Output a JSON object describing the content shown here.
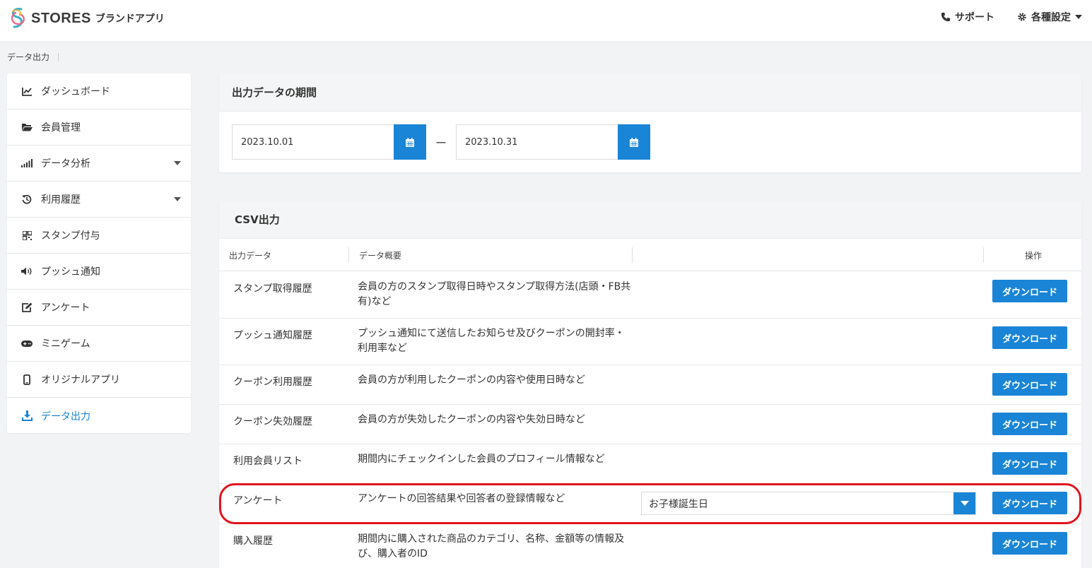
{
  "header": {
    "brand": "STORES",
    "brand_sub": "ブランドアプリ",
    "support_label": "サポート",
    "settings_label": "各種設定"
  },
  "breadcrumb": {
    "current": "データ出力"
  },
  "sidebar": {
    "items": [
      {
        "label": "ダッシュボード",
        "icon": "chart-line-icon"
      },
      {
        "label": "会員管理",
        "icon": "folder-icon"
      },
      {
        "label": "データ分析",
        "icon": "signal-bars-icon"
      },
      {
        "label": "利用履歴",
        "icon": "history-icon"
      },
      {
        "label": "スタンプ付与",
        "icon": "qrcode-icon"
      },
      {
        "label": "プッシュ通知",
        "icon": "volume-icon"
      },
      {
        "label": "アンケート",
        "icon": "edit-icon"
      },
      {
        "label": "ミニゲーム",
        "icon": "gamepad-icon"
      },
      {
        "label": "オリジナルアプリ",
        "icon": "mobile-icon"
      },
      {
        "label": "データ出力",
        "icon": "download-icon"
      }
    ]
  },
  "period": {
    "title": "出力データの期間",
    "start": "2023.10.01",
    "end": "2023.10.31",
    "separator": "ー"
  },
  "csv": {
    "title": "CSV出力",
    "columns": [
      "出力データ",
      "データ概要",
      "",
      "操作"
    ],
    "rows": [
      {
        "name": "スタンプ取得履歴",
        "desc": "会員の方のスタンプ取得日時やスタンプ取得方法(店頭・FB共有)など",
        "button": "ダウンロード"
      },
      {
        "name": "プッシュ通知履歴",
        "desc": "プッシュ通知にて送信したお知らせ及びクーポンの開封率・利用率など",
        "button": "ダウンロード"
      },
      {
        "name": "クーポン利用履歴",
        "desc": "会員の方が利用したクーポンの内容や使用日時など",
        "button": "ダウンロード"
      },
      {
        "name": "クーポン失効履歴",
        "desc": "会員の方が失効したクーポンの内容や失効日時など",
        "button": "ダウンロード"
      },
      {
        "name": "利用会員リスト",
        "desc": "期間内にチェックインした会員のプロフィール情報など",
        "button": "ダウンロード"
      },
      {
        "name": "アンケート",
        "desc": "アンケートの回答結果や回答者の登録情報など",
        "button": "ダウンロード",
        "select": "お子様誕生日"
      },
      {
        "name": "購入履歴",
        "desc": "期間内に購入された商品のカテゴリ、名称、金額等の情報及び、購入者のID",
        "button": "ダウンロード"
      }
    ]
  },
  "colors": {
    "accent": "#1a84d6",
    "highlight": "#e0141e"
  }
}
